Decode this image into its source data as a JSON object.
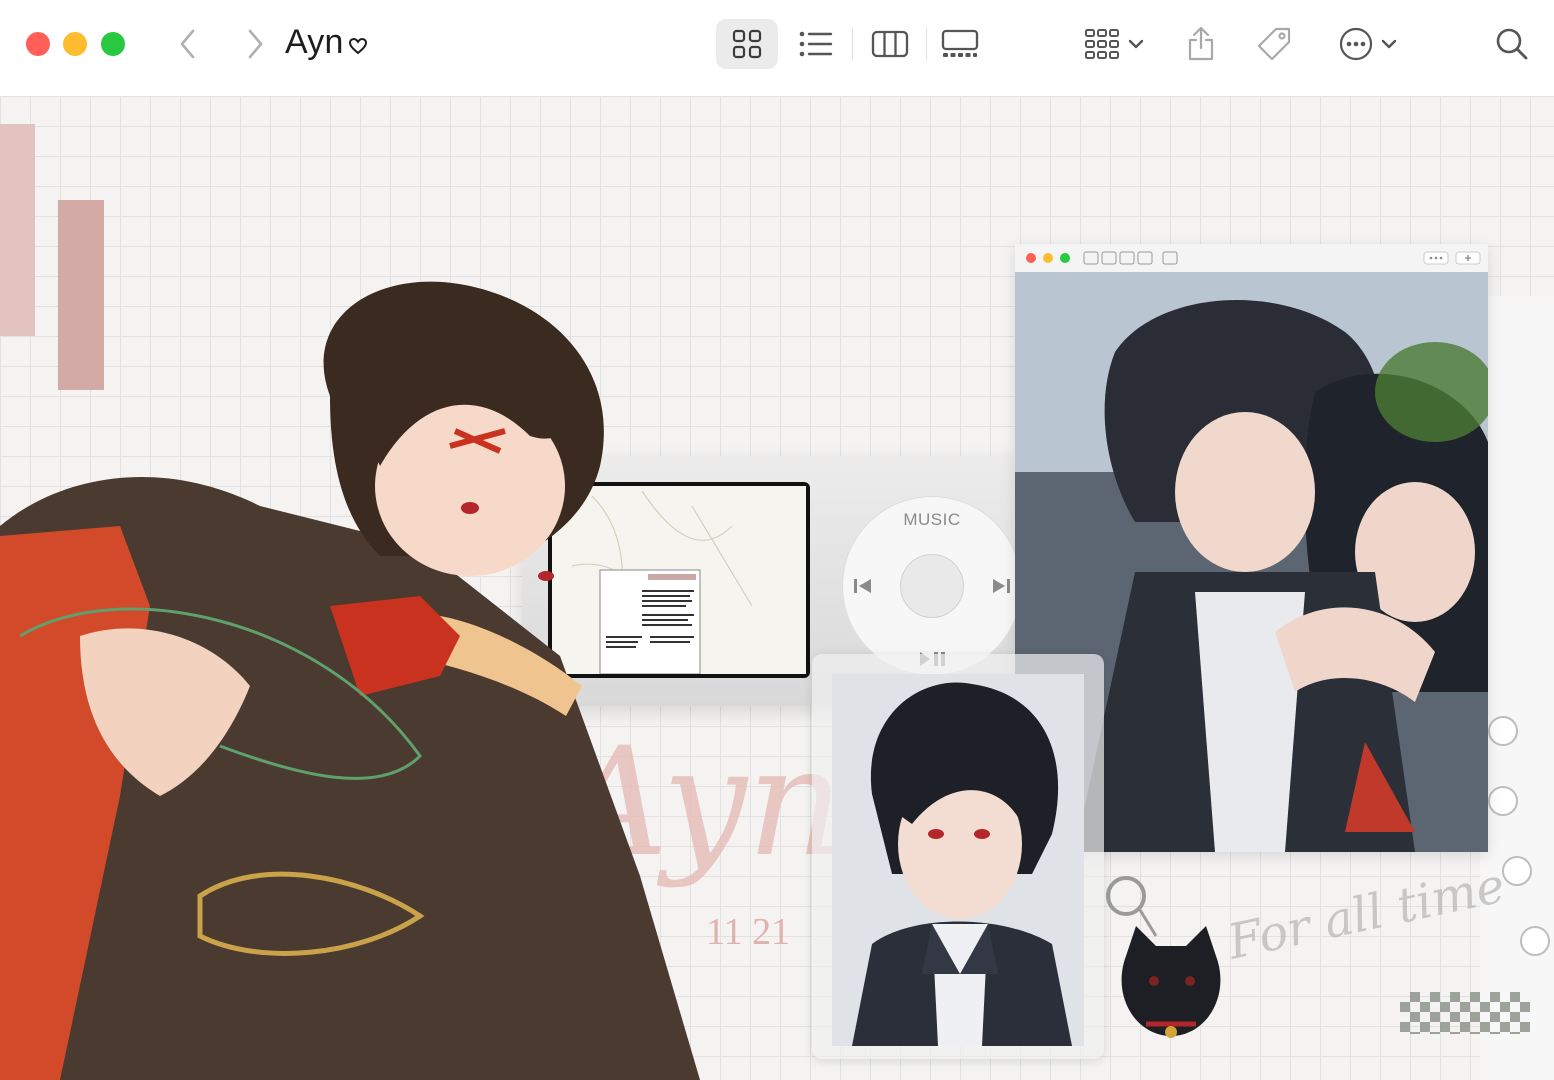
{
  "window": {
    "title": "Ayn",
    "title_suffix_icon": "heart-outline-icon",
    "traffic_lights": {
      "close": "#fe5f57",
      "minimize": "#febc2e",
      "zoom": "#28c840"
    }
  },
  "toolbar": {
    "back_icon": "chevron-left-icon",
    "forward_icon": "chevron-right-icon",
    "view_modes": [
      {
        "icon": "grid-view-icon",
        "selected": true
      },
      {
        "icon": "list-view-icon",
        "selected": false
      },
      {
        "icon": "column-view-icon",
        "selected": false
      },
      {
        "icon": "gallery-view-icon",
        "selected": false
      }
    ],
    "group_icon": "group-grid-icon",
    "share_icon": "share-icon",
    "tag_icon": "tag-icon",
    "more_icon": "ellipsis-circle-icon",
    "search_icon": "search-icon"
  },
  "desktop": {
    "ipod_wheel_label": "MUSIC",
    "date_text": "11 21",
    "signature_text": "Ayn",
    "script_text": "For all time"
  }
}
